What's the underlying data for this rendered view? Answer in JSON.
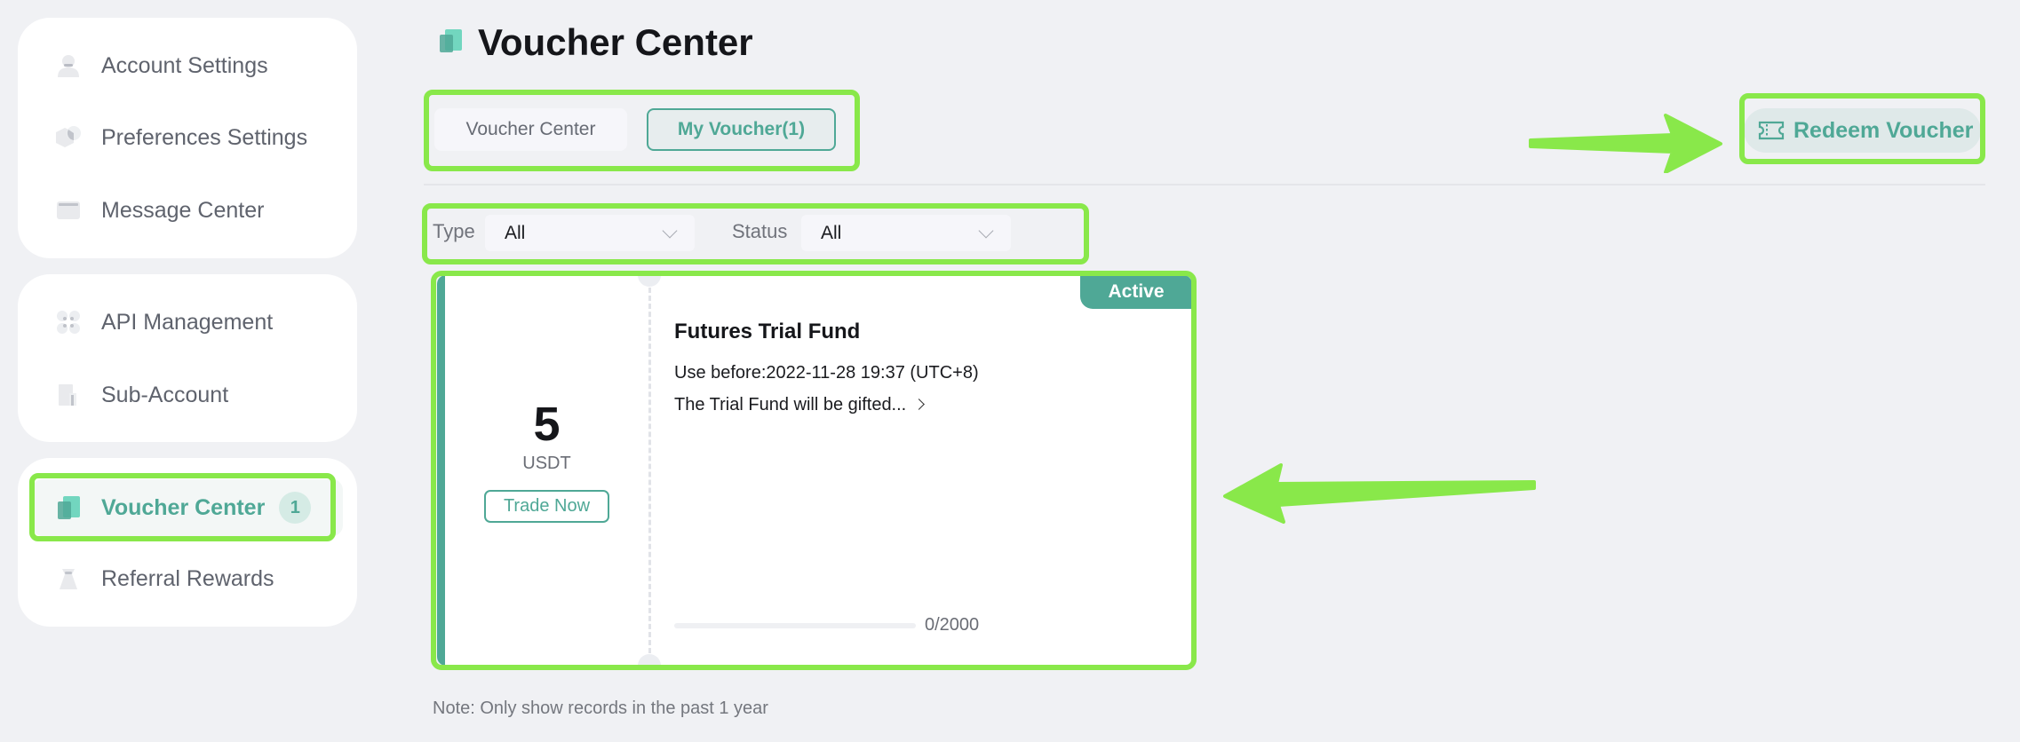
{
  "sidebar": {
    "groups": [
      {
        "items": [
          {
            "label": "Account Settings",
            "icon": "user-icon"
          },
          {
            "label": "Preferences Settings",
            "icon": "preferences-icon"
          },
          {
            "label": "Message Center",
            "icon": "message-icon"
          }
        ]
      },
      {
        "items": [
          {
            "label": "API Management",
            "icon": "api-icon"
          },
          {
            "label": "Sub-Account",
            "icon": "sub-account-icon"
          }
        ]
      },
      {
        "items": [
          {
            "label": "Voucher Center",
            "icon": "voucher-icon",
            "active": true,
            "badge": "1"
          },
          {
            "label": "Referral Rewards",
            "icon": "referral-icon"
          }
        ]
      }
    ]
  },
  "header": {
    "title": "Voucher Center",
    "tabs": [
      {
        "label": "Voucher Center",
        "active": false
      },
      {
        "label": "My Voucher(1)",
        "active": true
      }
    ],
    "redeem_label": "Redeem Voucher"
  },
  "filters": {
    "type": {
      "label": "Type",
      "value": "All"
    },
    "status": {
      "label": "Status",
      "value": "All"
    }
  },
  "vouchers": [
    {
      "amount": "5",
      "unit": "USDT",
      "action_label": "Trade Now",
      "status": "Active",
      "title": "Futures Trial Fund",
      "expiry": "Use before:2022-11-28 19:37 (UTC+8)",
      "description": "The Trial Fund will be gifted...",
      "progress_text": "0/2000",
      "progress_fraction": 0
    }
  ],
  "note": "Note: Only show records in the past 1 year",
  "colors": {
    "accent": "#4fa896",
    "highlight": "#89e84a",
    "background": "#f0f1f4"
  }
}
